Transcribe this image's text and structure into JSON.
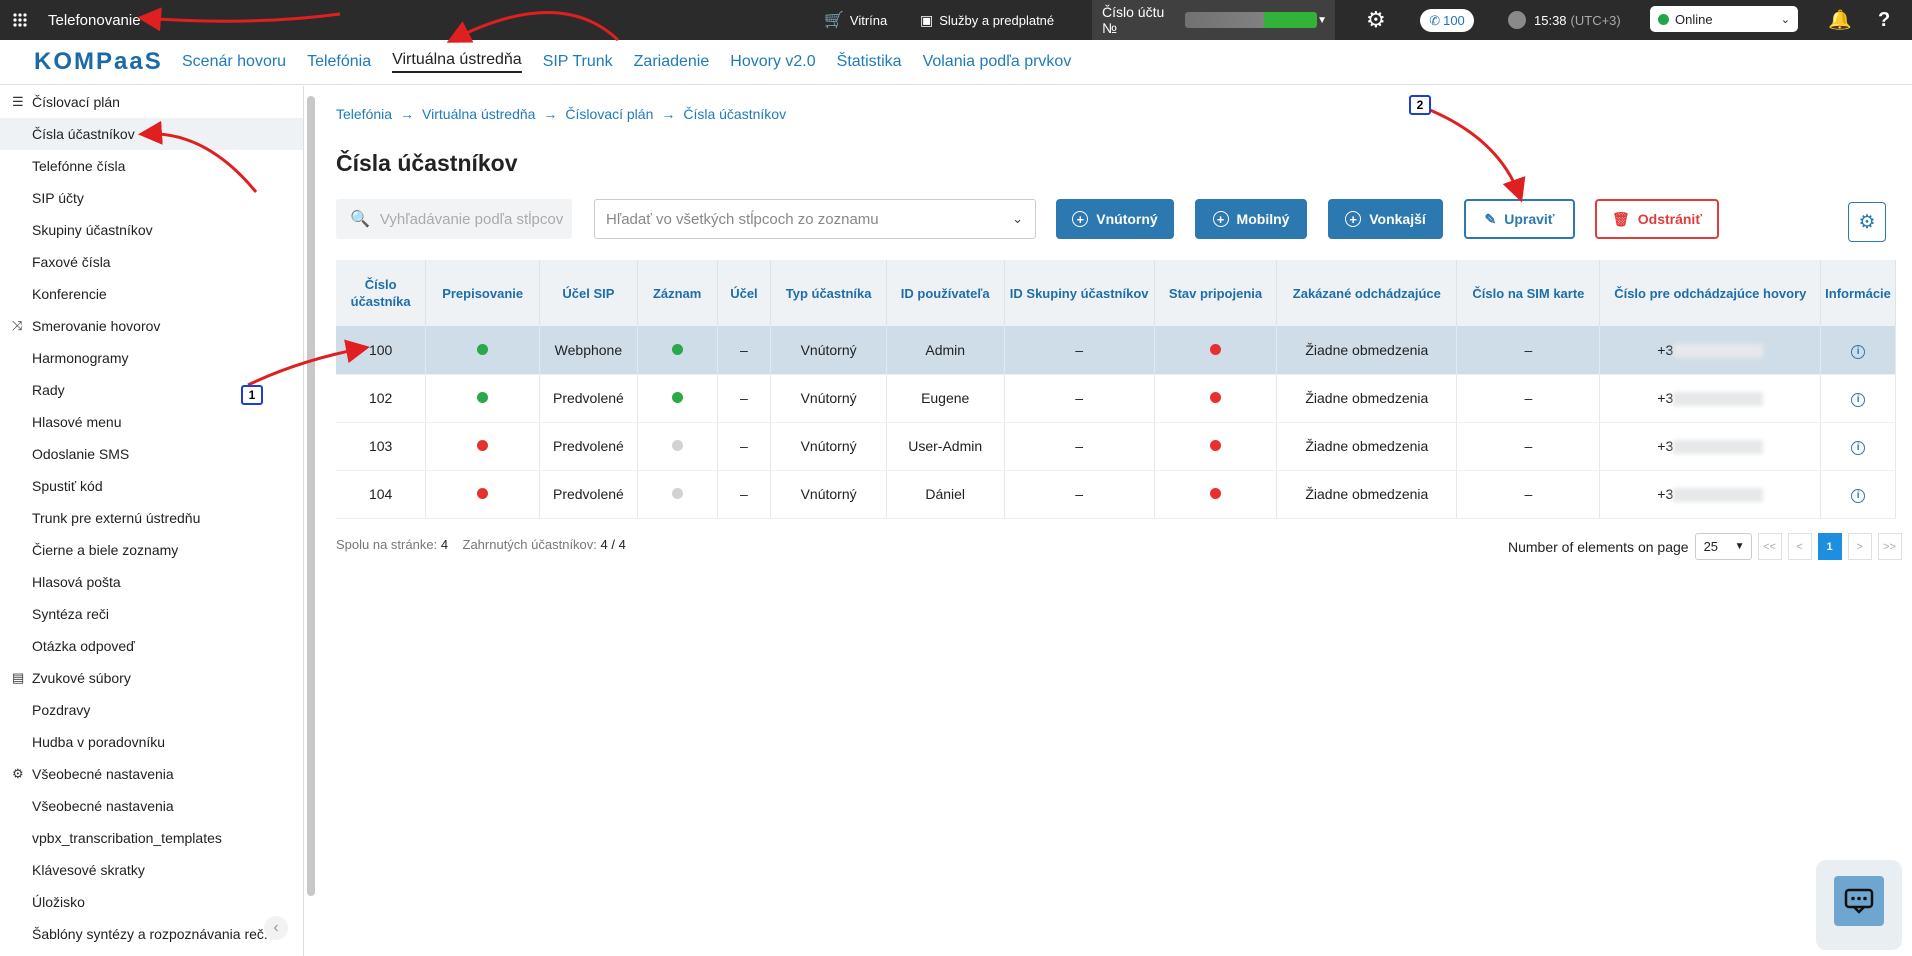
{
  "topbar": {
    "app_title": "Telefonovanie",
    "vitrina": "Vitrína",
    "services": "Služby a predplatné",
    "account_label": "Číslo účtu №",
    "calls_count": "100",
    "time": "15:38",
    "timezone": "(UTC+3)",
    "status": "Online"
  },
  "nav": {
    "logo": "KOMPaaS",
    "items": [
      "Scenár hovoru",
      "Telefónia",
      "Virtuálna ústredňa",
      "SIP Trunk",
      "Zariadenie",
      "Hovory v2.0",
      "Štatistika",
      "Volania podľa prvkov"
    ],
    "active": "Virtuálna ústredňa"
  },
  "sidebar": {
    "groups": [
      {
        "title": "Číslovací plán",
        "icon": "list-icon",
        "items": [
          "Čísla účastníkov",
          "Telefónne čísla",
          "SIP účty",
          "Skupiny účastníkov",
          "Faxové čísla",
          "Konferencie"
        ]
      },
      {
        "title": "Smerovanie hovorov",
        "icon": "route-icon",
        "items": [
          "Harmonogramy",
          "Rady",
          "Hlasové menu",
          "Odoslanie SMS",
          "Spustiť kód",
          "Trunk pre externú ústredňu",
          "Čierne a biele zoznamy",
          "Hlasová pošta",
          "Syntéza reči",
          "Otázka odpoveď"
        ]
      },
      {
        "title": "Zvukové súbory",
        "icon": "audio-files-icon",
        "items": [
          "Pozdravy",
          "Hudba v poradovníku"
        ]
      },
      {
        "title": "Všeobecné nastavenia",
        "icon": "gear-icon",
        "items": [
          "Všeobecné nastavenia",
          "vpbx_transcribation_templates",
          "Klávesové skratky",
          "Úložisko",
          "Šablóny syntézy a rozpoznávania reč."
        ]
      }
    ],
    "selected": "Čísla účastníkov"
  },
  "breadcrumb": [
    "Telefónia",
    "Virtuálna ústredňa",
    "Číslovací plán",
    "Čísla účastníkov"
  ],
  "page_title": "Čísla účastníkov",
  "toolbar": {
    "search_placeholder": "Vyhľadávanie podľa stĺpcov",
    "select_placeholder": "Hľadať vo všetkých stĺpcoch zo zoznamu",
    "btn_internal": "Vnútorný",
    "btn_mobile": "Mobilný",
    "btn_external": "Vonkajší",
    "btn_edit": "Upraviť",
    "btn_delete": "Odstrániť"
  },
  "table": {
    "headers": [
      "Číslo účastníka",
      "Prepisovanie",
      "Účel SIP",
      "Záznam",
      "Účel",
      "Typ účastníka",
      "ID používateľa",
      "ID Skupiny účastníkov",
      "Stav pripojenia",
      "Zakázané odchádzajúce",
      "Číslo na SIM karte",
      "Číslo pre odchádzajúce hovory",
      "Informácie"
    ],
    "rows": [
      {
        "number": "100",
        "transcribe": "green",
        "sip": "Webphone",
        "record": "green",
        "purpose": "–",
        "type": "Vnútorný",
        "user": "Admin",
        "group": "–",
        "conn": "red",
        "forbid": "Žiadne obmedzenia",
        "sim": "–",
        "outnum": "+3",
        "selected": true
      },
      {
        "number": "102",
        "transcribe": "green",
        "sip": "Predvolené",
        "record": "green",
        "purpose": "–",
        "type": "Vnútorný",
        "user": "Eugene",
        "group": "–",
        "conn": "red",
        "forbid": "Žiadne obmedzenia",
        "sim": "–",
        "outnum": "+3",
        "selected": false
      },
      {
        "number": "103",
        "transcribe": "red",
        "sip": "Predvolené",
        "record": "gray",
        "purpose": "–",
        "type": "Vnútorný",
        "user": "User-Admin",
        "group": "–",
        "conn": "red",
        "forbid": "Žiadne obmedzenia",
        "sim": "–",
        "outnum": "+3",
        "selected": false
      },
      {
        "number": "104",
        "transcribe": "red",
        "sip": "Predvolené",
        "record": "gray",
        "purpose": "–",
        "type": "Vnútorný",
        "user": "Dániel",
        "group": "–",
        "conn": "red",
        "forbid": "Žiadne obmedzenia",
        "sim": "–",
        "outnum": "+3",
        "selected": false
      }
    ]
  },
  "footer": {
    "total_label": "Spolu na stránke:",
    "total_value": "4",
    "included_label": "Zahrnutých účastníkov:",
    "included_value": "4 / 4",
    "per_page_label": "Number of elements on page",
    "per_page_value": "25",
    "current_page": "1",
    "first": "<<",
    "prev": "<",
    "next": ">",
    "last": ">>"
  },
  "annotations": [
    "1",
    "2"
  ],
  "colors": {
    "accent": "#2c78b0",
    "danger": "#e23b3b",
    "topbar": "#2b2b2b",
    "arrow": "#e02020"
  }
}
